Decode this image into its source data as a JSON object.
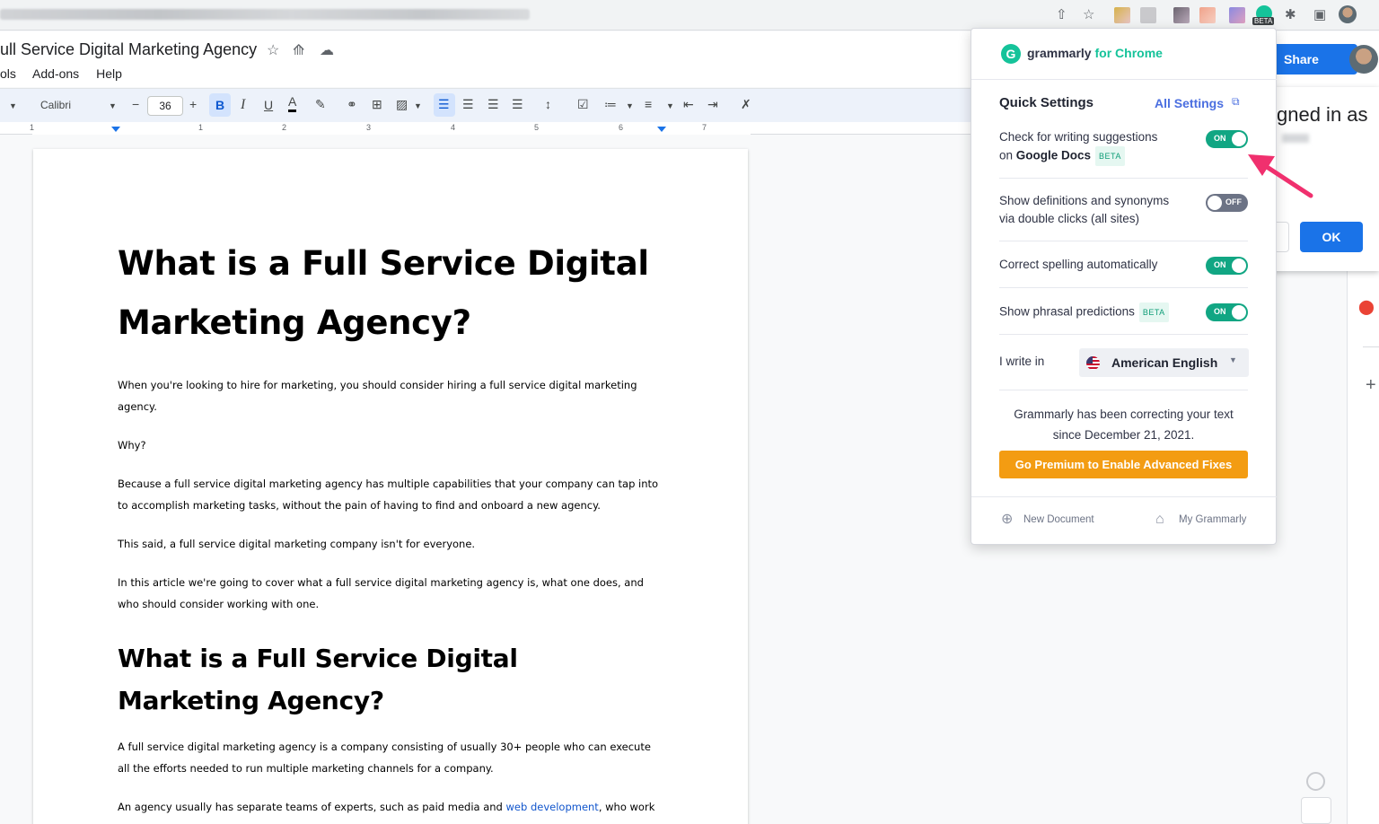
{
  "browser": {
    "url_blurred": true,
    "share_icon": "share-page-icon",
    "bookmark_icon": "star-icon",
    "extensions_icon": "puzzle-icon",
    "beta_label": "BETA"
  },
  "docs": {
    "title": "ull Service Digital Marketing Agency",
    "menus": [
      "ols",
      "Add-ons",
      "Help"
    ],
    "share_label": "Share",
    "toolbar": {
      "font_family": "Calibri",
      "font_size": "36",
      "minus": "−",
      "plus": "+",
      "bold": "B",
      "italic": "I",
      "underline": "U",
      "text_color": "A"
    },
    "ruler_numbers": [
      "1",
      "1",
      "2",
      "3",
      "4",
      "5",
      "6",
      "7"
    ]
  },
  "document": {
    "h1": "What is a Full Service Digital Marketing Agency?",
    "p1": "When you're looking to hire for marketing, you should consider hiring a full service digital marketing agency.",
    "p2": "Why?",
    "p3": "Because a full service digital marketing agency has multiple capabilities that your company can tap into to accomplish marketing tasks, without the pain of having to find and onboard a new agency.",
    "p4": "This said, a full service digital marketing company isn't for everyone.",
    "p5": "In this article we're going to cover what a full service digital marketing agency is, what one does, and who should consider working with one.",
    "h2": "What is a Full Service Digital Marketing Agency?",
    "p6": "A full service digital marketing agency is a company consisting of usually 30+ people who can execute all the efforts needed to run multiple marketing channels for a company.",
    "p7_before": "An agency usually has separate teams of experts, such as paid media and ",
    "p7_link": "web development",
    "p7_after": ", who work together to execute a client's full digital marketing strategy. The teams are held together by project and account managers who make sure that work is being completed according to plan and getting results."
  },
  "signed_in_dialog": {
    "text": "gned in as",
    "ok_label": "OK"
  },
  "grammarly": {
    "brand": "grammarly",
    "brand_sub": "for Chrome",
    "quick_settings": "Quick Settings",
    "all_settings": "All Settings",
    "settings": [
      {
        "label_line1": "Check for writing suggestions",
        "label_line2_prefix": "on ",
        "label_line2_bold": "Google Docs",
        "beta": "BETA",
        "state": "ON"
      },
      {
        "label_line1": "Show definitions and synonyms",
        "label_line2": "via double clicks (all sites)",
        "state": "OFF"
      },
      {
        "label": "Correct spelling automatically",
        "state": "ON"
      },
      {
        "label": "Show phrasal predictions",
        "beta": "BETA",
        "state": "ON"
      }
    ],
    "i_write_in": "I write in",
    "language": "American English",
    "correcting_text_1": "Grammarly has been correcting your text",
    "correcting_text_2": "since December 21, 2021.",
    "premium_button": "Go Premium to Enable Advanced Fixes",
    "new_document": "New Document",
    "my_grammarly": "My Grammarly",
    "colors": {
      "accent": "#15c39a",
      "toggle_on": "#11a683",
      "toggle_off": "#6c7385",
      "premium": "#f39c12",
      "link": "#4a6ee0"
    }
  },
  "annotation": {
    "arrow_color": "#f0306e"
  }
}
